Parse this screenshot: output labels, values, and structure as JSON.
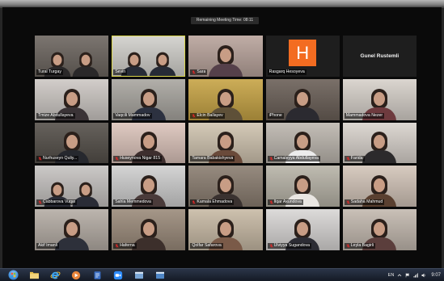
{
  "meeting": {
    "timer_label": "Remaining Meeting Time: 08:11"
  },
  "colors": {
    "screen_background": "#0a0a0a",
    "active_speaker_border": "#d8d44a",
    "muted_icon": "#e02828",
    "taskbar": "#141a25"
  },
  "participants": [
    {
      "name": "Tural Turgay",
      "muted": false,
      "video": true,
      "people": 2,
      "bg": "#6d6660",
      "shirt": "#2a2829"
    },
    {
      "name": "Sevin",
      "muted": false,
      "video": true,
      "people": 2,
      "bg": "#d2d1cc",
      "shirt": "#262b36",
      "active_speaker": true
    },
    {
      "name": "Sara",
      "muted": true,
      "video": true,
      "people": 1,
      "bg": "#b9a49c",
      "shirt": "#55404a"
    },
    {
      "name": "Rasgarq Hesoyeva",
      "muted": false,
      "video": false,
      "avatar": {
        "letter": "H",
        "color": "#f36c21"
      }
    },
    {
      "name": "Gunel Rustemli",
      "muted": false,
      "video": false
    },
    {
      "name": "Tmize Abdullayeva",
      "muted": false,
      "video": true,
      "people": 1,
      "bg": "#cdc8c4",
      "shirt": "#3a3336"
    },
    {
      "name": "Vaqcili Mammadov",
      "muted": false,
      "video": true,
      "people": 1,
      "bg": "#a9a6a0",
      "shirt": "#2c3140"
    },
    {
      "name": "Elcin Ballayev",
      "muted": true,
      "video": true,
      "people": 1,
      "bg": "#c7a445",
      "shirt": "#5e5038"
    },
    {
      "name": "iPhone",
      "muted": false,
      "video": true,
      "people": 1,
      "bg": "#6b6058",
      "shirt": "#2b2a30"
    },
    {
      "name": "Mammadova Nezer",
      "muted": false,
      "video": true,
      "people": 1,
      "bg": "#d7d1ca",
      "shirt": "#6e3a3e"
    },
    {
      "name": "Nurhuseyn Quliy...",
      "muted": true,
      "video": true,
      "people": 1,
      "bg": "#55504a",
      "shirt": "#26282e"
    },
    {
      "name": "Huseynova Nigar 815",
      "muted": true,
      "video": true,
      "people": 1,
      "bg": "#dcc4bb",
      "shirt": "#3d2e2e"
    },
    {
      "name": "Tamara Babakishyeva",
      "muted": false,
      "video": true,
      "people": 1,
      "bg": "#d0c4b0",
      "shirt": "#6a4a3a"
    },
    {
      "name": "Camaleyya Abdullayeva",
      "muted": true,
      "video": true,
      "people": 1,
      "bg": "#bdb7af",
      "shirt": "#ececec"
    },
    {
      "name": "Farida",
      "muted": true,
      "video": true,
      "people": 1,
      "bg": "#d9d3cd",
      "shirt": "#2c2a2c"
    },
    {
      "name": "Cabbarova Vuqar",
      "muted": true,
      "video": true,
      "people": 2,
      "bg": "#c6c3c1",
      "shirt": "#2a2c36"
    },
    {
      "name": "Sahla Memmedova",
      "muted": false,
      "video": true,
      "people": 1,
      "bg": "#d0d0d0",
      "shirt": "#4a3b3a"
    },
    {
      "name": "Kamala Ehmadova",
      "muted": true,
      "video": true,
      "people": 1,
      "bg": "#8b7e71",
      "shirt": "#3a3230"
    },
    {
      "name": "Ilqar Axundova",
      "muted": true,
      "video": true,
      "people": 1,
      "bg": "#b8b4a8",
      "shirt": "#e9e6e2"
    },
    {
      "name": "Sadaha Mahmud",
      "muted": true,
      "video": true,
      "people": 1,
      "bg": "#d3c5b9",
      "shirt": "#5a4030"
    },
    {
      "name": "Akif Imanli",
      "muted": false,
      "video": true,
      "people": 1,
      "bg": "#b5ada5",
      "shirt": "#2d303a"
    },
    {
      "name": "Haferna",
      "muted": true,
      "video": true,
      "people": 1,
      "bg": "#9b8b7b",
      "shirt": "#3c2f2b"
    },
    {
      "name": "Qolfar Safarova",
      "muted": false,
      "video": true,
      "people": 1,
      "bg": "#c8baa5",
      "shirt": "#7a5a48"
    },
    {
      "name": "Ulviyya Sugandova",
      "muted": true,
      "video": true,
      "people": 1,
      "bg": "#d9d7d5",
      "shirt": "#2c2c34"
    },
    {
      "name": "Leyla Bagirli",
      "muted": true,
      "video": true,
      "people": 1,
      "bg": "#c3b9af",
      "shirt": "#5b3e3c"
    }
  ],
  "taskbar": {
    "apps": [
      {
        "icon": "windows-start-icon",
        "color": "#2f7fd0"
      },
      {
        "icon": "folder-icon",
        "color": "#e7bf4e"
      },
      {
        "icon": "internet-explorer-icon",
        "color": "#3ea1ea"
      },
      {
        "icon": "media-player-icon",
        "color": "#e8843a"
      },
      {
        "icon": "document-icon",
        "color": "#3b6fc4"
      },
      {
        "icon": "zoom-icon",
        "color": "#2d8cff"
      },
      {
        "icon": "window-icon",
        "color": "#7aa6d6"
      },
      {
        "icon": "window-icon",
        "color": "#4f86c6"
      }
    ],
    "language": "EN",
    "tray_icons": [
      "chevron-up-icon",
      "flag-icon",
      "network-icon",
      "volume-icon"
    ],
    "time": "9:07"
  }
}
